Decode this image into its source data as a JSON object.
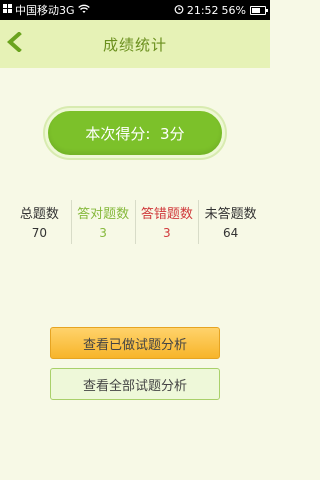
{
  "status_bar": {
    "carrier": "中国移动3G",
    "time": "21:52",
    "battery": "56%",
    "battery_level": 0.56
  },
  "header": {
    "title": "成绩统计",
    "back_icon": "chevron-left-icon"
  },
  "score": {
    "text": "本次得分:  3分"
  },
  "stats": [
    {
      "label": "总题数",
      "value": "70"
    },
    {
      "label": "答对题数",
      "value": "3"
    },
    {
      "label": "答错题数",
      "value": "3"
    },
    {
      "label": "未答题数",
      "value": "64"
    }
  ],
  "buttons": {
    "view_done": "查看已做试题分析",
    "view_all": "查看全部试题分析"
  },
  "colors": {
    "accent": "#7cc12a",
    "correct": "#86b93c",
    "wrong": "#d0393b",
    "header_bg": "#e6f2b6",
    "done_button": "#f7b52a"
  }
}
